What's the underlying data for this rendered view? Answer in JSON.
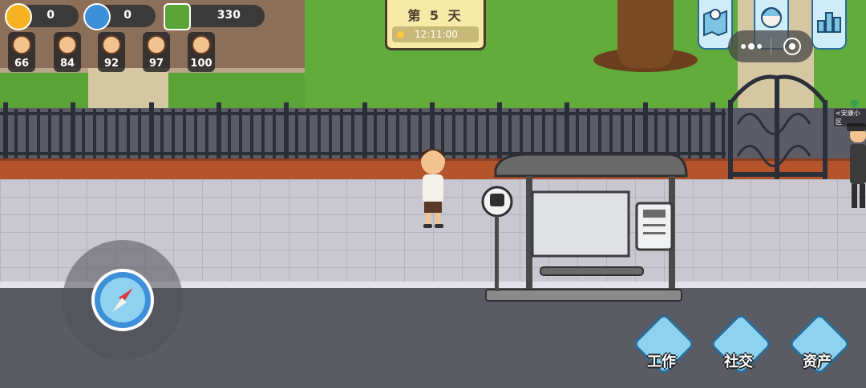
{
  "resources": {
    "coins": "0",
    "diamonds": "0",
    "cash": "330"
  },
  "stats": [
    "66",
    "84",
    "92",
    "97",
    "100"
  ],
  "day_board": {
    "day_label": "第 5 天",
    "time": "12:11:00"
  },
  "npc": {
    "name": "李",
    "sub": "<安康小区"
  },
  "actions": {
    "work": "工作",
    "social": "社交",
    "assets": "资产"
  },
  "colors": {
    "grass": "#5aa337",
    "sidewalk": "#c9c8d0",
    "road": "#5b5b64",
    "wall": "#b4542c",
    "accent_blue": "#2b6d9b"
  },
  "icons": {
    "coin": "coin-icon",
    "diamond": "user-icon",
    "cash": "money-icon",
    "map": "map-icon",
    "profile": "profile-icon",
    "ranking": "ranking-icon",
    "compass": "compass-icon"
  }
}
